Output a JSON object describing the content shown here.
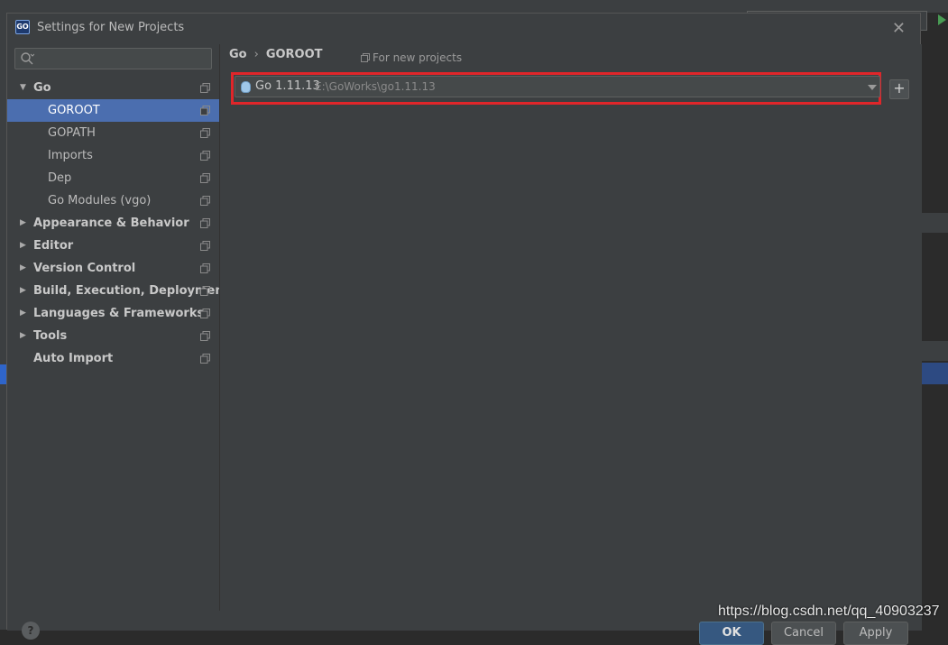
{
  "window": {
    "title": "Settings for New Projects",
    "app_icon_text": "GO"
  },
  "search": {
    "placeholder": ""
  },
  "tree": [
    {
      "label": "Go",
      "expanded": true,
      "bold": true,
      "level": 0,
      "selected": false
    },
    {
      "label": "GOROOT",
      "level": 1,
      "selected": true
    },
    {
      "label": "GOPATH",
      "level": 1,
      "selected": false
    },
    {
      "label": "Imports",
      "level": 1,
      "selected": false
    },
    {
      "label": "Dep",
      "level": 1,
      "selected": false
    },
    {
      "label": "Go Modules (vgo)",
      "level": 1,
      "selected": false
    },
    {
      "label": "Appearance & Behavior",
      "expanded": false,
      "bold": true,
      "level": 0,
      "selected": false
    },
    {
      "label": "Editor",
      "expanded": false,
      "bold": true,
      "level": 0,
      "selected": false
    },
    {
      "label": "Version Control",
      "expanded": false,
      "bold": true,
      "level": 0,
      "selected": false
    },
    {
      "label": "Build, Execution, Deployment",
      "expanded": false,
      "bold": true,
      "level": 0,
      "selected": false
    },
    {
      "label": "Languages & Frameworks",
      "expanded": false,
      "bold": true,
      "level": 0,
      "selected": false
    },
    {
      "label": "Tools",
      "expanded": false,
      "bold": true,
      "level": 0,
      "selected": false
    },
    {
      "label": "Auto Import",
      "bold": true,
      "level": 0,
      "leaf": true,
      "selected": false
    }
  ],
  "breadcrumb": {
    "parent": "Go",
    "separator": "›",
    "current": "GOROOT"
  },
  "scope_note": "For new projects",
  "sdk": {
    "name": "Go 1.11.13",
    "path": "E:\\GoWorks\\go1.11.13"
  },
  "add_button": "+",
  "footer": {
    "help": "?",
    "ok": "OK",
    "cancel": "Cancel",
    "apply": "Apply"
  },
  "watermark": "https://blog.csdn.net/qq_40903237",
  "colors": {
    "highlight_border": "#e0262a",
    "selection": "#4b6eaf",
    "panel_bg": "#3c3f41"
  }
}
